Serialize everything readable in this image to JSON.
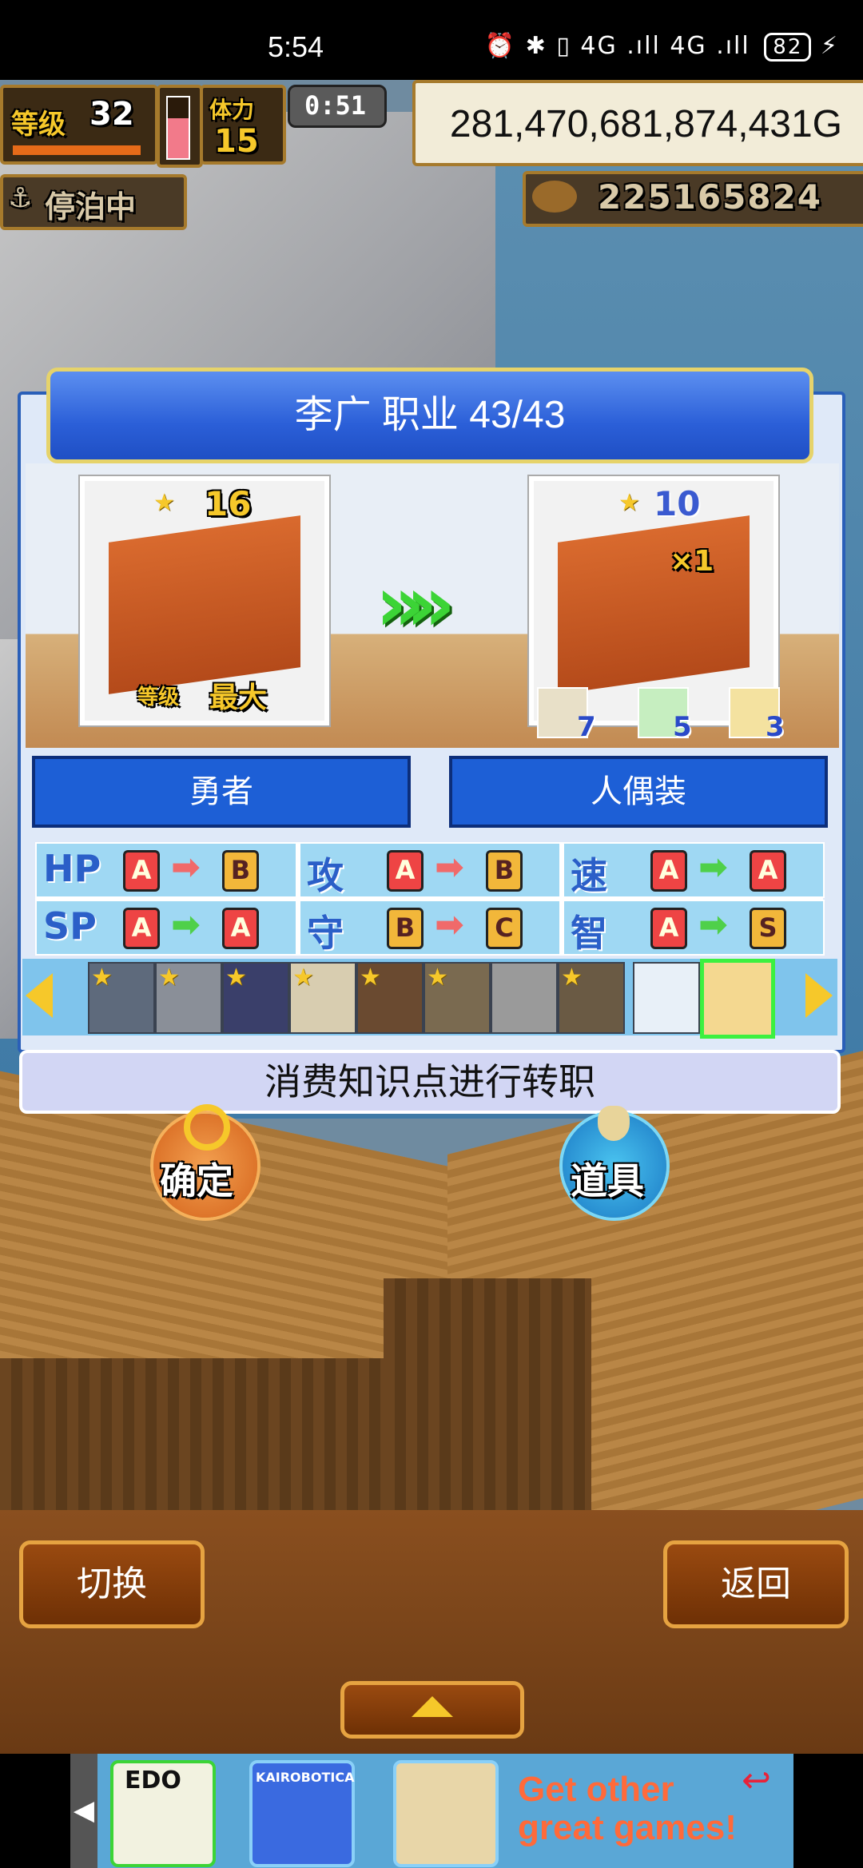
{
  "status_bar": {
    "time": "5:54",
    "icons": "⏰ ✱ ▯ 4G .ıll 4G .ıll",
    "battery": "82"
  },
  "hud": {
    "level_label": "等级",
    "level_value": "32",
    "stamina_label": "体力",
    "stamina_value": "15",
    "timer": "0:51",
    "gold": "281,470,681,874,431G",
    "status_label": "停泊中",
    "food_amount": "225165824"
  },
  "dialog": {
    "title": "李广  职业 43/43",
    "current_job": {
      "stars": "16",
      "level_label": "等级",
      "level_value": "最大"
    },
    "next_job": {
      "stars": "10",
      "multiplier": "×1",
      "items": [
        "7",
        "5",
        "3"
      ]
    },
    "current_job_name": "勇者",
    "next_job_name": "人偶装",
    "stats": [
      {
        "label": "HP",
        "from": "A",
        "to": "B",
        "arrow_color": "#f06a6a"
      },
      {
        "label": "攻",
        "from": "A",
        "to": "B",
        "arrow_color": "#f06a6a"
      },
      {
        "label": "速",
        "from": "A",
        "to": "A",
        "arrow_color": "#4fd04a"
      },
      {
        "label": "SP",
        "from": "A",
        "to": "A",
        "arrow_color": "#4fd04a"
      },
      {
        "label": "守",
        "from": "B",
        "to": "C",
        "arrow_color": "#f06a6a"
      },
      {
        "label": "智",
        "from": "A",
        "to": "S",
        "arrow_color": "#4fd04a"
      }
    ],
    "info_text": "消费知识点进行转职"
  },
  "actions": {
    "confirm_label": "确定",
    "items_label": "道具"
  },
  "bottom_bar": {
    "switch_label": "切换",
    "back_label": "返回"
  },
  "ad_banner": {
    "game1": "EDO",
    "game2": "KAIROBOTICA",
    "tagline_line1": "Get other",
    "tagline_line2": "great games!"
  }
}
